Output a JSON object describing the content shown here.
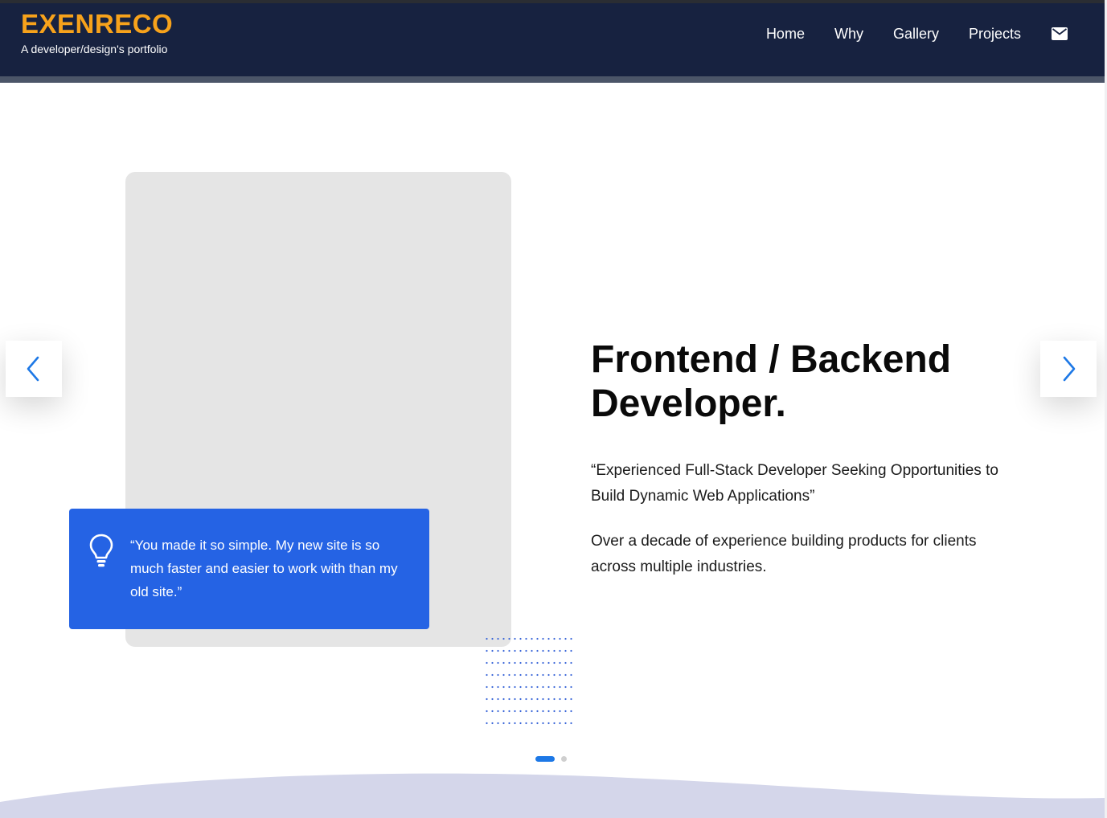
{
  "header": {
    "logo": "EXENRECO",
    "tagline": "A developer/design's portfolio",
    "nav": [
      "Home",
      "Why",
      "Gallery",
      "Projects"
    ],
    "mail_icon": "envelope-icon"
  },
  "hero": {
    "headline": "Frontend / Backend Developer.",
    "quote": "“Experienced Full-Stack Developer Seeking Opportunities to Build Dynamic Web Applications”",
    "summary": "Over a decade of experience building products for clients across multiple industries."
  },
  "testimonial": {
    "icon": "lightbulb-icon",
    "text": "“You made it so simple. My new site is so much faster and easier to work with than my old site.”"
  },
  "carousel": {
    "prev_icon": "chevron-left-icon",
    "next_icon": "chevron-right-icon",
    "slide_count": 2,
    "active_slide": 1
  },
  "colors": {
    "header_bg": "#172240",
    "logo": "#f7a21b",
    "accent_blue": "#2563e4",
    "arrow_blue": "#1d78e6",
    "wave": "#d4d6ea"
  }
}
